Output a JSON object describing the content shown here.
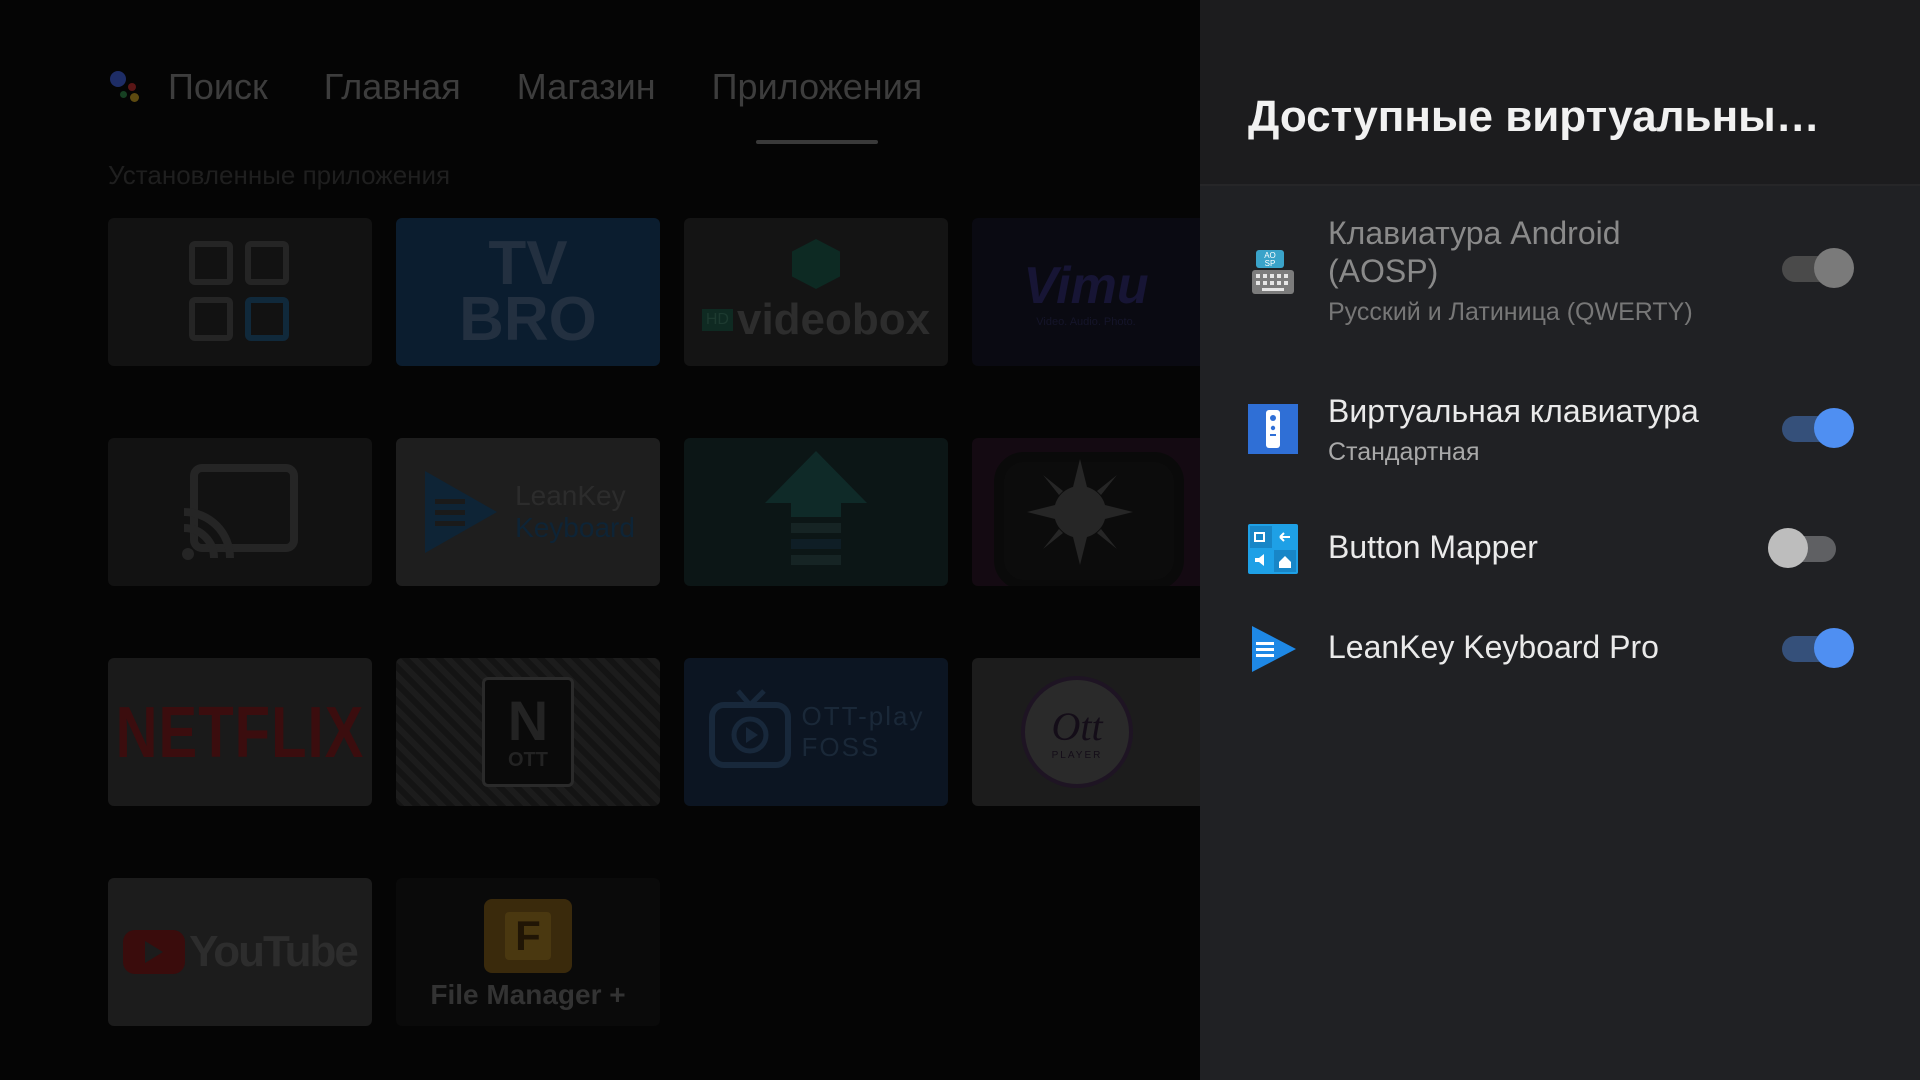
{
  "launcher": {
    "nav": {
      "search": "Поиск",
      "home": "Главная",
      "store": "Магазин",
      "apps": "Приложения"
    },
    "section_title": "Установленные приложения",
    "apps": [
      {
        "name": "apps-grid",
        "label": ""
      },
      {
        "name": "TV Bro",
        "label": "TV BRO"
      },
      {
        "name": "videobox",
        "label": "videobox",
        "badge": "HD"
      },
      {
        "name": "Vimu",
        "label": "Vimu",
        "sub": "Video. Audio. Photo."
      },
      {
        "name": "cast",
        "label": ""
      },
      {
        "name": "LeanKey Keyboard",
        "label_line1": "LeanKey",
        "label_line2": "Keyboard"
      },
      {
        "name": "uploader",
        "label": ""
      },
      {
        "name": "sun-tv",
        "label": ""
      },
      {
        "name": "Netflix",
        "label": "NETFLIX"
      },
      {
        "name": "OTT Navigator",
        "label": "OTT"
      },
      {
        "name": "OTT-play FOSS",
        "label_line1": "OTT-play",
        "label_line2": "FOSS"
      },
      {
        "name": "OTT Player",
        "label": "Ott",
        "sub": "PLAYER"
      },
      {
        "name": "YouTube",
        "label": "YouTube"
      },
      {
        "name": "File Manager +",
        "label": "File Manager +",
        "letter": "F"
      }
    ]
  },
  "panel": {
    "title": "Доступные виртуальны…",
    "keyboards": [
      {
        "title_line1": "Клавиатура Android",
        "title_line2": "(AOSP)",
        "subtitle": "Русский и Латиница (QWERTY)",
        "enabled": true,
        "dimmed": true,
        "icon": "aosp-keyboard-icon"
      },
      {
        "title_line1": "Виртуальная клавиатура",
        "subtitle": "Стандартная",
        "enabled": true,
        "dimmed": false,
        "icon": "remote-keyboard-icon"
      },
      {
        "title_line1": "Button Mapper",
        "subtitle": "",
        "enabled": false,
        "dimmed": false,
        "icon": "button-mapper-icon"
      },
      {
        "title_line1": "LeanKey Keyboard Pro",
        "subtitle": "",
        "enabled": true,
        "dimmed": false,
        "icon": "leankey-icon"
      }
    ],
    "colors": {
      "toggle_on_knob": "#4f8ff2",
      "toggle_on_track": "#35507a",
      "toggle_off_knob": "#bdbdbd",
      "toggle_off_track": "#5f6063",
      "toggle_dim_knob": "#7a7a7a",
      "toggle_dim_track": "#4a4a4a"
    }
  }
}
